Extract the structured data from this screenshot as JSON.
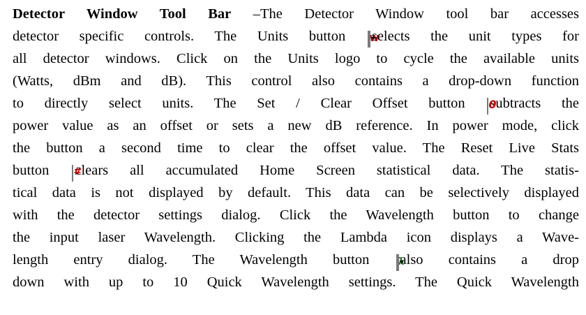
{
  "title": "Detector Window Tool Bar",
  "lines": [
    {
      "a": " –The Detector Window tool bar accesses"
    },
    {
      "a": "detector specific controls. The Units button ",
      "b": " selects the unit types for"
    },
    {
      "a": "all detector windows. Click on the Units logo to cycle the available units"
    },
    {
      "a": "(Watts, dBm and dB). This control also contains a drop-down function"
    },
    {
      "a": "to directly select units. The Set / Clear Offset button ",
      "b": " subtracts the"
    },
    {
      "a": "power value as an offset or sets a new dB reference. In power mode, click"
    },
    {
      "a": "the button a second time to clear the offset value. The Reset Live Stats"
    },
    {
      "a": "button ",
      "b": " clears all accumulated Home Screen statistical data. The statis-"
    },
    {
      "a": "tical data is not displayed by default. This data can be selectively displayed"
    },
    {
      "a": "with the detector settings dialog. Click the Wavelength button  to change"
    },
    {
      "a": "the input laser Wavelength. Clicking the Lambda icon displays a Wave-"
    },
    {
      "a": "length entry dialog. The Wavelength button ",
      "b": " also contains a drop"
    },
    {
      "a": "down with up to 10 Quick Wavelength settings. The Quick Wavelength"
    }
  ],
  "icons": {
    "units": "W",
    "offset": "0",
    "reset": "#",
    "lambda": "λ"
  }
}
